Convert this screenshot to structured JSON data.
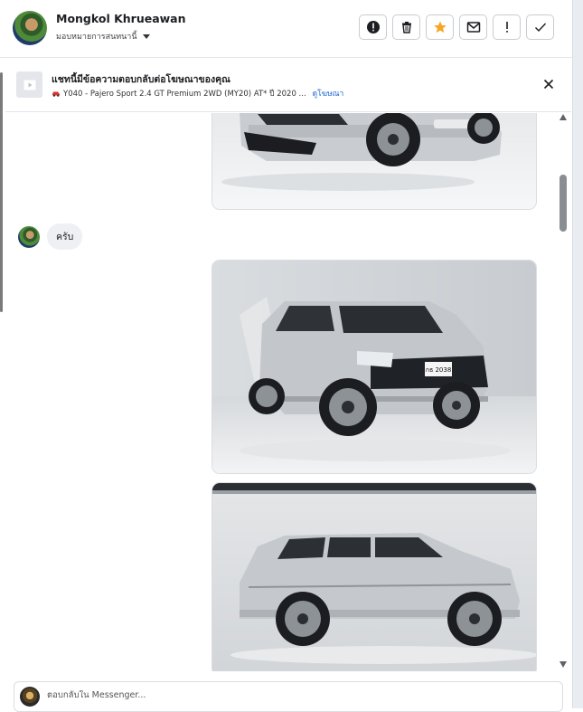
{
  "header": {
    "contact_name": "Mongkol Khrueawan",
    "assign_label": "มอบหมายการสนทนานี้",
    "actions": [
      {
        "name": "mark-spam-icon",
        "label": "!"
      },
      {
        "name": "trash-icon",
        "label": "delete"
      },
      {
        "name": "star-icon",
        "label": "star"
      },
      {
        "name": "mail-icon",
        "label": "mail"
      },
      {
        "name": "exclamation-icon",
        "label": "!"
      },
      {
        "name": "check-icon",
        "label": "done"
      }
    ],
    "colors": {
      "star": "#f5a623"
    }
  },
  "banner": {
    "title": "แชทนี้มีข้อความตอบกลับต่อโฆษณาของคุณ",
    "subtitle": "Y040 - Pajero Sport 2.4 GT Premium 2WD (MY20) AT* ปี 2020 ...",
    "link": "ดูโฆษณา",
    "link_color": "#1a63d6"
  },
  "messages": [
    {
      "type": "image",
      "from": "page",
      "content": "car-front-partial"
    },
    {
      "type": "text",
      "from": "contact",
      "text": "ครับ"
    },
    {
      "type": "image",
      "from": "page",
      "content": "car-front-three-quarter",
      "plate": "กธ 2038"
    },
    {
      "type": "image",
      "from": "page",
      "content": "car-side"
    }
  ],
  "composer": {
    "placeholder": "ตอบกลับใน Messenger..."
  }
}
